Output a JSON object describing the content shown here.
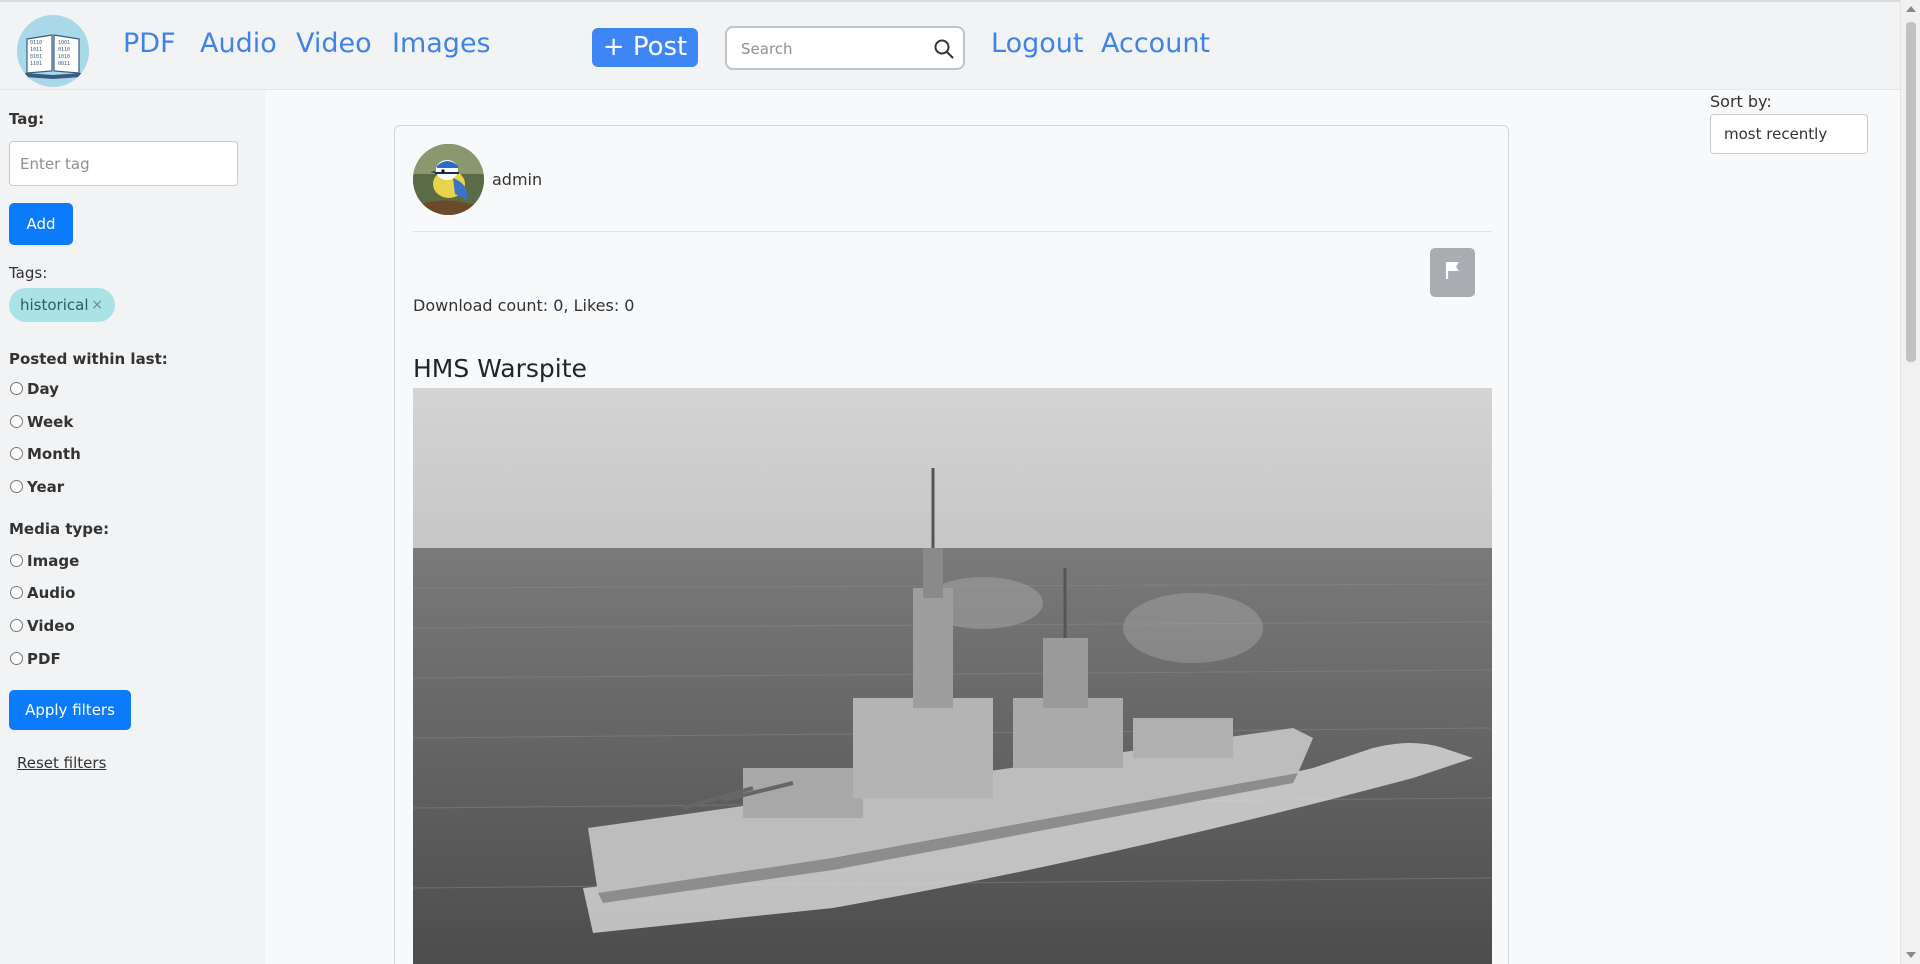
{
  "nav": {
    "links": [
      "PDF",
      "Audio",
      "Video",
      "Images"
    ],
    "post_label": "+ Post",
    "search_placeholder": "Search",
    "logout_label": "Logout",
    "account_label": "Account"
  },
  "sidebar": {
    "tag_label": "Tag:",
    "tag_placeholder": "Enter tag",
    "add_label": "Add",
    "tags_label": "Tags:",
    "tags": [
      {
        "label": "historical",
        "remove": "×"
      }
    ],
    "posted_within_label": "Posted within last:",
    "posted_options": [
      "Day",
      "Week",
      "Month",
      "Year"
    ],
    "media_type_label": "Media type:",
    "media_options": [
      "Image",
      "Audio",
      "Video",
      "PDF"
    ],
    "apply_label": "Apply filters",
    "reset_label": "Reset filters"
  },
  "sort": {
    "label": "Sort by:",
    "selected": "most recently"
  },
  "post": {
    "author": "admin",
    "stats": "Download count: 0, Likes: 0",
    "title": "HMS Warspite",
    "flag_icon": "flag-icon",
    "image_icon": "warship-photo"
  },
  "colors": {
    "accent": "#3f84e5",
    "button": "#0b7bfa",
    "chip": "#a9e3e6",
    "flag_button": "#a9adb1"
  }
}
